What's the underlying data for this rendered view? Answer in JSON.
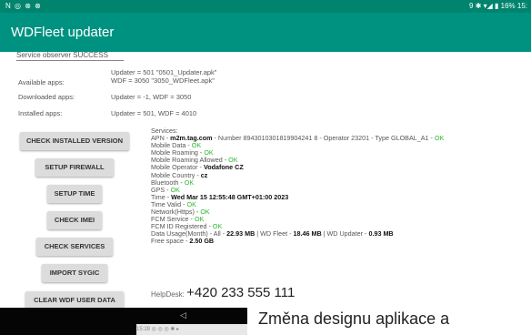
{
  "status_bar": {
    "left_icons": "N ◎ ⊗ ⊗",
    "right_text": "9 ✱ ▾◢ ▮ 16% 15:"
  },
  "app": {
    "title": "WDFleet updater"
  },
  "observer": "Service observer SUCCESS",
  "info": {
    "available_label": "Available apps:",
    "available_value_1": "Updater = 501 \"0501_Updater.apk\"",
    "available_value_2": "WDF = 3050 \"3050_WDFleet.apk\"",
    "downloaded_label": "Downloaded apps:",
    "downloaded_value": "Updater = -1, WDF = 3050",
    "installed_label": "Installed apps:",
    "installed_value": "Updater = 501, WDF = 4010"
  },
  "buttons": {
    "check_installed": "CHECK INSTALLED VERSION",
    "setup_firewall": "SETUP FIREWALL",
    "setup_time": "SETUP TIME",
    "check_imei": "CHECK IMEI",
    "check_services": "CHECK SERVICES",
    "import_sygic": "IMPORT SYGIC",
    "clear_user_data": "CLEAR WDF USER DATA"
  },
  "services": {
    "heading": "Services:",
    "apn_prefix": "APN -",
    "apn_value": "m2m.tag.com",
    "apn_rest": "- Number 8943010301819904241 8 - Operator 23201 - Type GLOBAL_A1 -",
    "mobile_data": "Mobile Data -",
    "mobile_roaming": "Mobile Roaming -",
    "mobile_roaming_allowed": "Mobile Roaming Allowed -",
    "mobile_operator": "Mobile Operator -",
    "mobile_operator_value": "Vodafone CZ",
    "mobile_country": "Mobile Country -",
    "mobile_country_value": "cz",
    "bluetooth": "Bluetooth -",
    "gps": "GPS -",
    "time": "Time -",
    "time_value": "Wed Mar 15 12:55:48 GMT+01:00 2023",
    "time_valid": "Time Valid -",
    "network": "Network(Https) -",
    "fcm_service": "FCM Service -",
    "fcm_registered": "FCM ID Registered -",
    "data_usage": "Data Usage(Month) - All -",
    "data_all": "22.93 MB",
    "data_wdfleet_label": "| WD Fleet -",
    "data_wdfleet": "18.46 MB",
    "data_updater_label": "| WD Updater -",
    "data_updater": "0.93 MB",
    "free_space": "Free space -",
    "free_space_value": "2.50 GB",
    "ok": "OK"
  },
  "helpdesk": {
    "label": "HelpDesk:",
    "phone": "+420 233 555 111"
  },
  "nav": {
    "back_icon": "◁",
    "mini_status": "15:28 ◎ ◎ ◎ ✱ ▸"
  },
  "caption": "Změna designu aplikace a"
}
